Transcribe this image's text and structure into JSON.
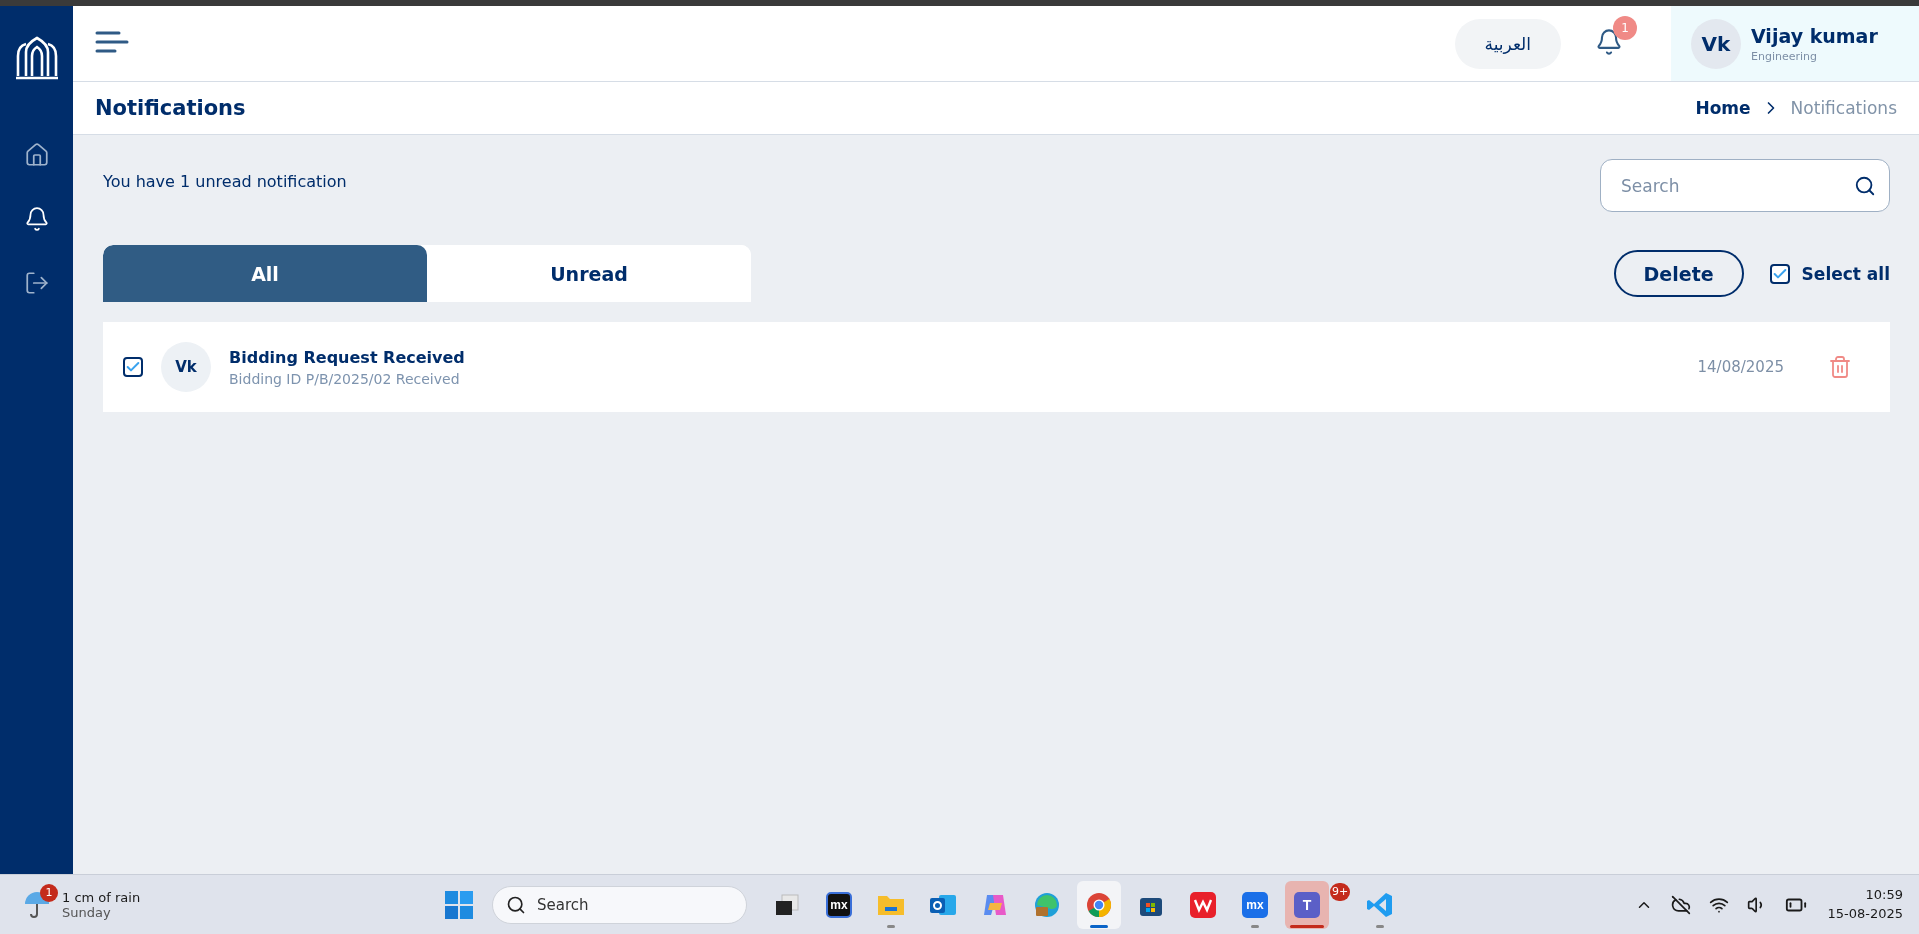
{
  "sidebar": {
    "items": [
      {
        "kind": "home",
        "selected": false
      },
      {
        "kind": "bell",
        "selected": true
      },
      {
        "kind": "logout",
        "selected": false
      }
    ]
  },
  "header": {
    "language": "العربية",
    "notification_count": "1",
    "user": {
      "initials": "Vk",
      "name": "Vijay kumar",
      "department": "Engineering"
    }
  },
  "page": {
    "title": "Notifications",
    "breadcrumb": [
      {
        "label": "Home",
        "selected": false
      },
      {
        "label": "Notifications",
        "selected": true
      }
    ]
  },
  "summary": "You have 1 unread notification",
  "search": {
    "placeholder": "Search"
  },
  "tabs": [
    {
      "label": "All",
      "selected": true
    },
    {
      "label": "Unread",
      "selected": false
    }
  ],
  "actions": {
    "delete": "Delete",
    "select_all": {
      "label": "Select all",
      "checked": true
    }
  },
  "notifications": [
    {
      "checked": true,
      "initials": "Vk",
      "title": "Bidding Request Received",
      "subtitle": "Bidding ID P/B/2025/02 Received",
      "date": "14/08/2025"
    }
  ],
  "taskbar": {
    "weather": {
      "badge": "1",
      "text": "1 cm of rain",
      "day": "Sunday"
    },
    "search": {
      "placeholder": "Search"
    },
    "apps": [
      {
        "kind": "taskview",
        "running": false,
        "selected": false,
        "flashing": false
      },
      {
        "kind": "mx",
        "label": "mx",
        "running": false,
        "selected": false,
        "flashing": false
      },
      {
        "kind": "folder",
        "running": true,
        "selected": false,
        "flashing": false
      },
      {
        "kind": "outlook",
        "running": false,
        "selected": false,
        "flashing": false
      },
      {
        "kind": "copilot",
        "running": false,
        "selected": false,
        "flashing": false
      },
      {
        "kind": "edge",
        "running": false,
        "selected": false,
        "flashing": false
      },
      {
        "kind": "chrome",
        "running": true,
        "selected": true,
        "flashing": false
      },
      {
        "kind": "store",
        "running": false,
        "selected": false,
        "flashing": false
      },
      {
        "kind": "wps",
        "running": false,
        "selected": false,
        "flashing": false
      },
      {
        "kind": "mxblue",
        "label": "mx",
        "running": true,
        "selected": false,
        "flashing": false
      },
      {
        "kind": "teams",
        "label": "T",
        "badge": "9+",
        "running": true,
        "selected": false,
        "flashing": true
      },
      {
        "kind": "vscode",
        "running": true,
        "selected": false,
        "flashing": false
      }
    ],
    "time": "10:59",
    "date": "15-08-2025"
  }
}
